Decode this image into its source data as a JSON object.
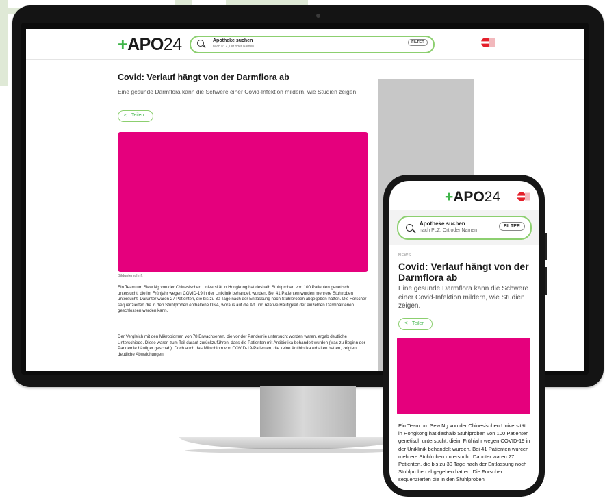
{
  "colors": {
    "brand_green": "#3fb549",
    "accent_pink": "#e5007d",
    "search_border": "#8ccf6f",
    "sidebar_gray": "#c7c7c7"
  },
  "desktop": {
    "logo_plus": "+",
    "logo_apo": "APO",
    "logo_num": "24",
    "search": {
      "title": "Apotheke suchen",
      "subtitle": "nach PLZ, Ort oder Namen",
      "filter_label": "FILTER"
    },
    "flag_icon": "austria-flag-icon",
    "article": {
      "title": "Covid: Verlauf hängt von der Darmflora ab",
      "lead": "Eine gesunde Darmflora kann die Schwere einer Covid-Infektion mildern, wie Studien zeigen.",
      "share_label": "Teilen",
      "caption": "Bildunterschrift",
      "paragraph1": "Ein Team um Siew Ng von der Chinesischen Universität in Hongkong hat deshalb Stuhlproben von 100 Patienten genetisch untersucht, die im Frühjahr wegen COVID-19 in der Uniklinik behandelt wurden. Bei 41 Patienten wurden mehrere Stuhlroben untersucht. Darunter waren 27 Patienten, die bis zu 30 Tage nach der Entlassung noch Stuhlproben abgegeben hatten. Die Forscher sequenzierten die in den Stuhlproben enthaltene DNA, woraus auf die Art und relative Häufigkeit der einzelnen Darmbakterien geschlossen werden kann.",
      "paragraph2": "Der Vergleich mit den Mikrobiomen von 78 Erwachsenen, die vor der Pandemie untersucht worden waren, ergab deutliche Unterschiede. Diese waren zum Teil darauf zurückzuführen, dass die Patienten mit Antibiotika behandelt wurden (was zu Beginn der Pandemie häufiger geschah). Doch auch das Mikrobiom von COVID-19-Patienten, die keine Antibiotika erhalten hatten, zeigten deutliche Abweichungen."
    }
  },
  "mobile": {
    "logo_plus": "+",
    "logo_apo": "APO",
    "logo_num": "24",
    "search": {
      "title": "Apotheke suchen",
      "subtitle": "nach PLZ, Ort oder Namen",
      "filter_label": "FILTER"
    },
    "category": "NEWS",
    "title": "Covid: Verlauf hängt von der Darmflora ab",
    "lead": "Eine gesunde Darmflora kann die Schwere einer Covid-Infektion mildern, wie Studien zeigen.",
    "share_label": "Teilen",
    "paragraph": "Ein Team um Sew Ng von der Chinesischen Universität in Hongkong hat deshalb Stuhlproben von 100 Patienten genetisch untersucht, dieim Frühjahr wegen COVID-19 in der Uniklinik behandelt wurden. Bei 41 Patienten wurcen mehrere Stuhlroben untersucht. Daunter waren 27 Patienten, die bis zu 30 Tage nach der Entlassung noch Stuhlproben abgegeben hatten. Die Forscher sequenzierten die in den Stuhlproben"
  }
}
